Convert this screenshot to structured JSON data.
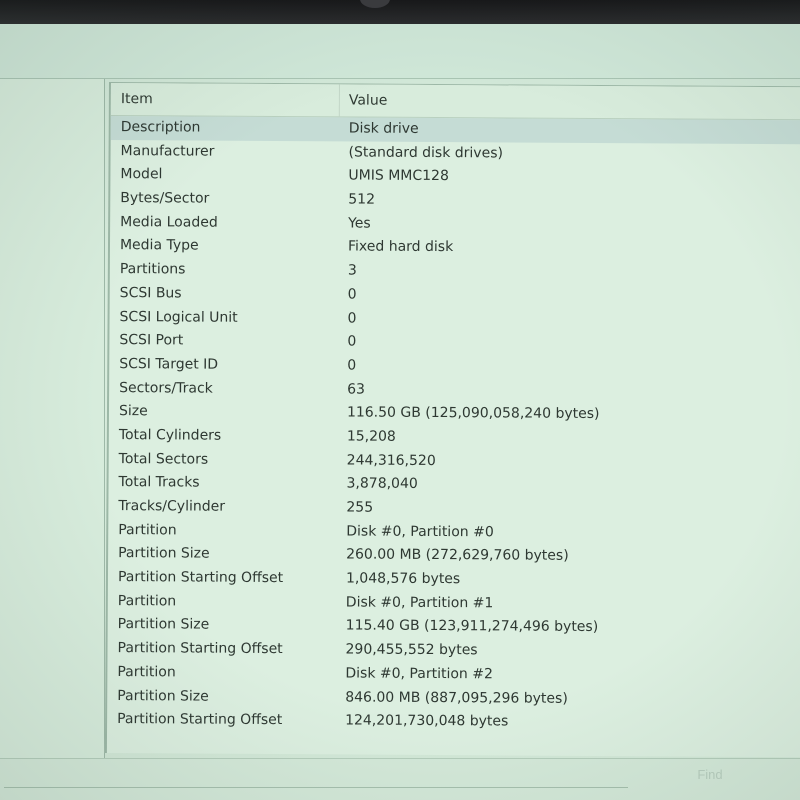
{
  "columns": {
    "item": "Item",
    "value": "Value"
  },
  "rows": [
    {
      "item": "Description",
      "value": "Disk drive",
      "selected": true
    },
    {
      "item": "Manufacturer",
      "value": "(Standard disk drives)"
    },
    {
      "item": "Model",
      "value": "UMIS MMC128"
    },
    {
      "item": "Bytes/Sector",
      "value": "512"
    },
    {
      "item": "Media Loaded",
      "value": "Yes"
    },
    {
      "item": "Media Type",
      "value": "Fixed hard disk"
    },
    {
      "item": "Partitions",
      "value": "3"
    },
    {
      "item": "SCSI Bus",
      "value": "0"
    },
    {
      "item": "SCSI Logical Unit",
      "value": "0"
    },
    {
      "item": "SCSI Port",
      "value": "0"
    },
    {
      "item": "SCSI Target ID",
      "value": "0"
    },
    {
      "item": "Sectors/Track",
      "value": "63"
    },
    {
      "item": "Size",
      "value": "116.50 GB (125,090,058,240 bytes)"
    },
    {
      "item": "Total Cylinders",
      "value": "15,208"
    },
    {
      "item": "Total Sectors",
      "value": "244,316,520"
    },
    {
      "item": "Total Tracks",
      "value": "3,878,040"
    },
    {
      "item": "Tracks/Cylinder",
      "value": "255"
    },
    {
      "item": "Partition",
      "value": "Disk #0, Partition #0"
    },
    {
      "item": "Partition Size",
      "value": "260.00 MB (272,629,760 bytes)"
    },
    {
      "item": "Partition Starting Offset",
      "value": "1,048,576 bytes"
    },
    {
      "item": "Partition",
      "value": "Disk #0, Partition #1"
    },
    {
      "item": "Partition Size",
      "value": "115.40 GB (123,911,274,496 bytes)"
    },
    {
      "item": "Partition Starting Offset",
      "value": "290,455,552 bytes"
    },
    {
      "item": "Partition",
      "value": "Disk #0, Partition #2"
    },
    {
      "item": "Partition Size",
      "value": "846.00 MB (887,095,296 bytes)"
    },
    {
      "item": "Partition Starting Offset",
      "value": "124,201,730,048 bytes"
    }
  ],
  "find": {
    "button_label": "Find"
  }
}
